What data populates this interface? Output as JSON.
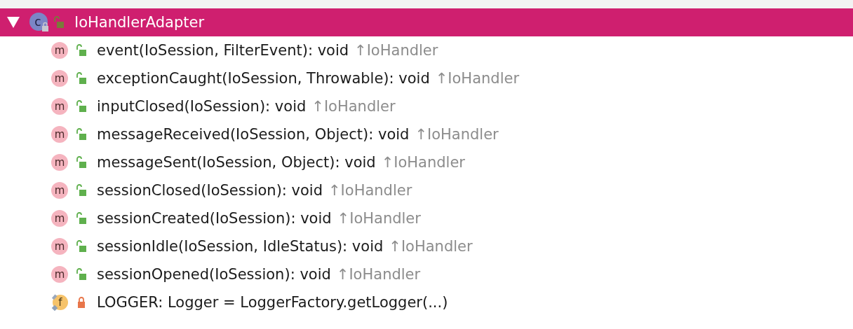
{
  "tree": {
    "label": "IoHandlerAdapter",
    "kind": "class",
    "icon_letter": "c",
    "private": false,
    "expanded": true,
    "selected": true,
    "children": [
      {
        "kind": "method",
        "icon_letter": "m",
        "private": false,
        "signature": "event(IoSession, FilterEvent): void",
        "origin": "↑IoHandler"
      },
      {
        "kind": "method",
        "icon_letter": "m",
        "private": false,
        "signature": "exceptionCaught(IoSession, Throwable): void",
        "origin": "↑IoHandler"
      },
      {
        "kind": "method",
        "icon_letter": "m",
        "private": false,
        "signature": "inputClosed(IoSession): void",
        "origin": "↑IoHandler"
      },
      {
        "kind": "method",
        "icon_letter": "m",
        "private": false,
        "signature": "messageReceived(IoSession, Object): void",
        "origin": "↑IoHandler"
      },
      {
        "kind": "method",
        "icon_letter": "m",
        "private": false,
        "signature": "messageSent(IoSession, Object): void",
        "origin": "↑IoHandler"
      },
      {
        "kind": "method",
        "icon_letter": "m",
        "private": false,
        "signature": "sessionClosed(IoSession): void",
        "origin": "↑IoHandler"
      },
      {
        "kind": "method",
        "icon_letter": "m",
        "private": false,
        "signature": "sessionCreated(IoSession): void",
        "origin": "↑IoHandler"
      },
      {
        "kind": "method",
        "icon_letter": "m",
        "private": false,
        "signature": "sessionIdle(IoSession, IdleStatus): void",
        "origin": "↑IoHandler"
      },
      {
        "kind": "method",
        "icon_letter": "m",
        "private": false,
        "signature": "sessionOpened(IoSession): void",
        "origin": "↑IoHandler"
      },
      {
        "kind": "field",
        "icon_letter": "f",
        "private": true,
        "signature": "LOGGER: Logger = LoggerFactory.getLogger(...)"
      }
    ]
  }
}
